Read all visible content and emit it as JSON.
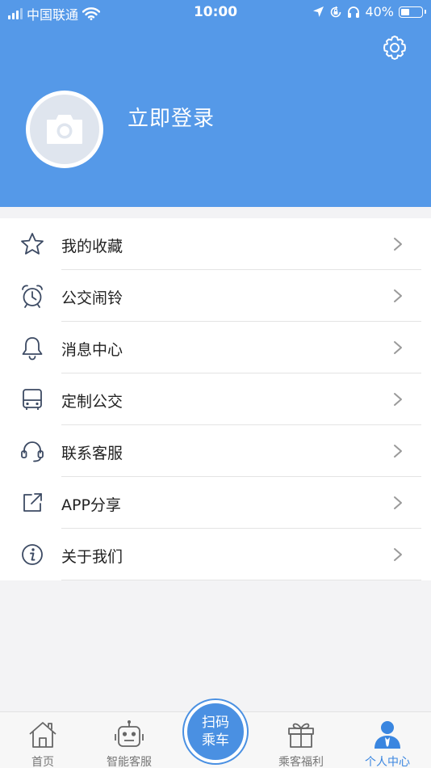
{
  "status_bar": {
    "carrier": "中国联通",
    "time": "10:00",
    "battery": "40%",
    "battery_level": 0.4,
    "icons": [
      "signal-icon",
      "wifi-icon",
      "location-icon",
      "lock-rotation-icon",
      "headphones-icon",
      "battery-icon"
    ]
  },
  "header": {
    "login_label": "立即登录",
    "avatar_icon": "camera-icon",
    "settings_icon": "gear-icon",
    "bg_color": "#5599e8"
  },
  "menu": {
    "items": [
      {
        "label": "我的收藏",
        "icon": "star-icon"
      },
      {
        "label": "公交闹铃",
        "icon": "alarm-clock-icon"
      },
      {
        "label": "消息中心",
        "icon": "bell-icon"
      },
      {
        "label": "定制公交",
        "icon": "bus-icon"
      },
      {
        "label": "联系客服",
        "icon": "headset-icon"
      },
      {
        "label": "APP分享",
        "icon": "share-icon"
      },
      {
        "label": "关于我们",
        "icon": "info-icon"
      }
    ]
  },
  "tabbar": {
    "home": "首页",
    "service": "智能客服",
    "scan_line1": "扫码",
    "scan_line2": "乘车",
    "welfare": "乘客福利",
    "profile": "个人中心",
    "active_color": "#3a86e0"
  }
}
